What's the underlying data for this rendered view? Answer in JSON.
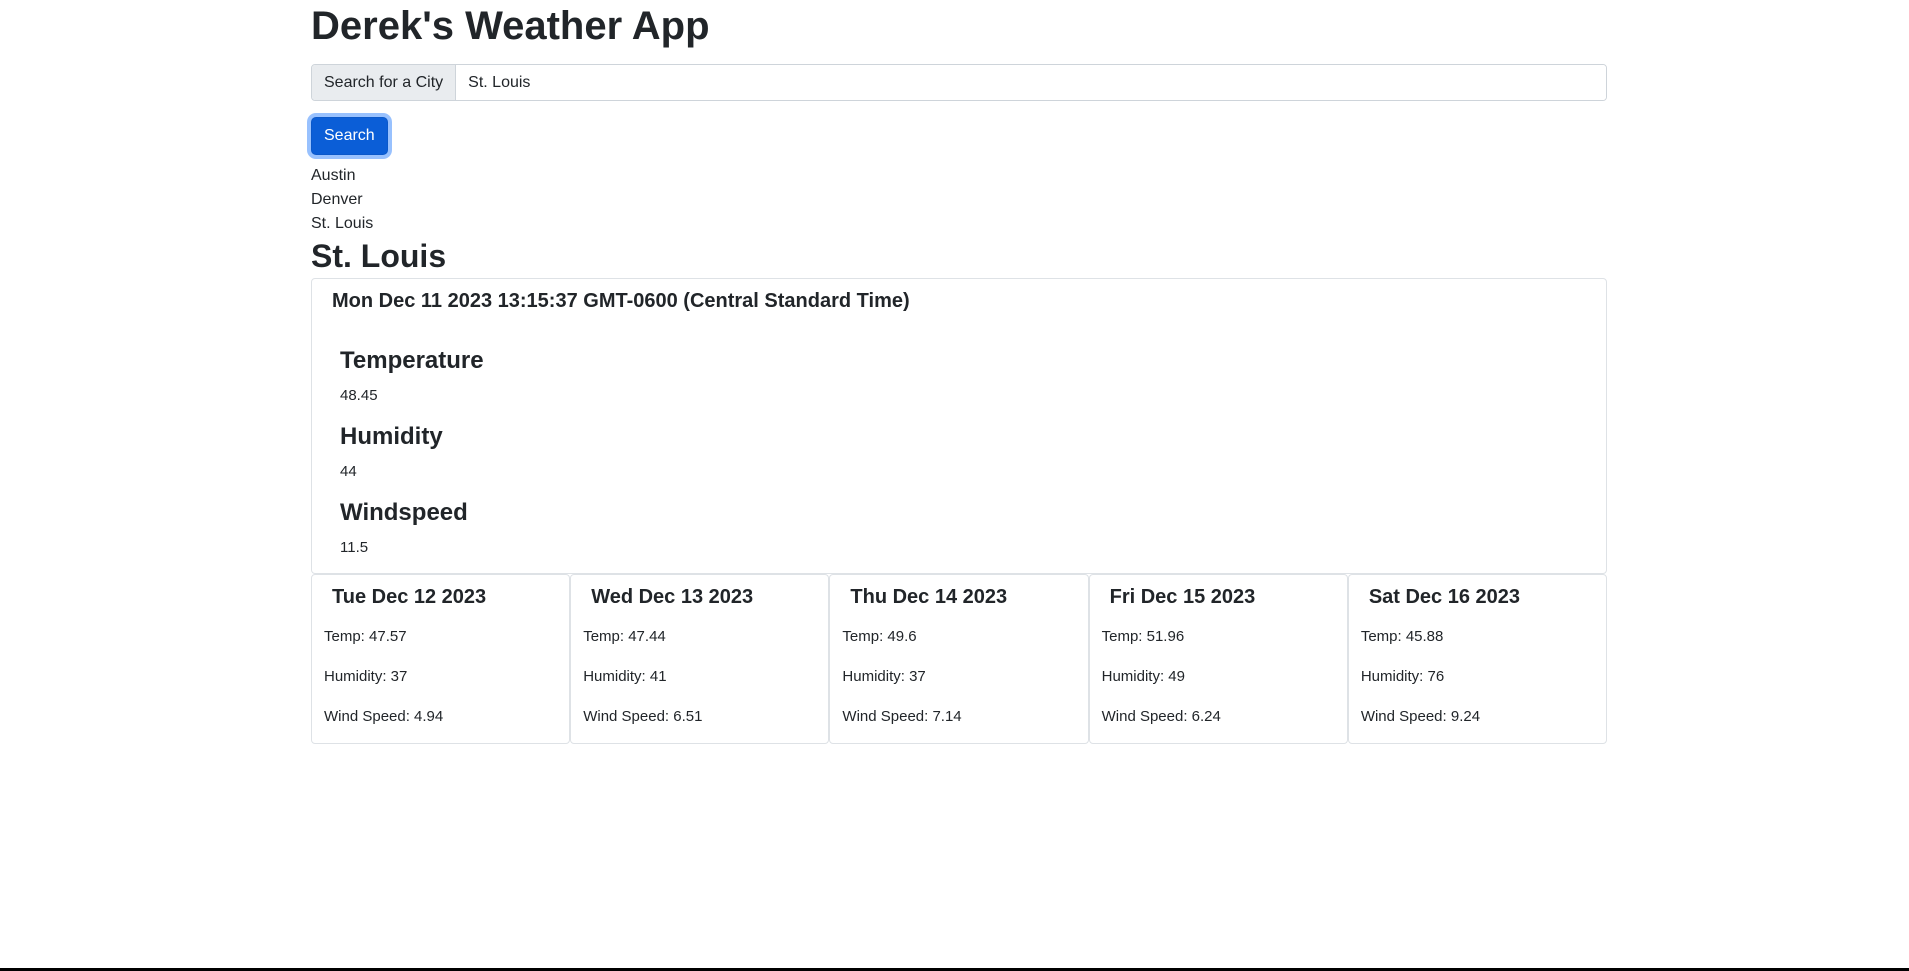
{
  "app": {
    "title": "Derek's Weather App"
  },
  "search": {
    "label": "Search for a City",
    "value": "St. Louis",
    "button_label": "Search"
  },
  "history": [
    "Austin",
    "Denver",
    "St. Louis"
  ],
  "current": {
    "city": "St. Louis",
    "datetime": "Mon Dec 11 2023 13:15:37 GMT-0600 (Central Standard Time)",
    "temperature_label": "Temperature",
    "temperature": "48.45",
    "humidity_label": "Humidity",
    "humidity": "44",
    "windspeed_label": "Windspeed",
    "windspeed": "11.5"
  },
  "forecast": [
    {
      "date": "Tue Dec 12 2023",
      "temp": "Temp: 47.57",
      "humidity": "Humidity: 37",
      "wind": "Wind Speed: 4.94"
    },
    {
      "date": "Wed Dec 13 2023",
      "temp": "Temp: 47.44",
      "humidity": "Humidity: 41",
      "wind": "Wind Speed: 6.51"
    },
    {
      "date": "Thu Dec 14 2023",
      "temp": "Temp: 49.6",
      "humidity": "Humidity: 37",
      "wind": "Wind Speed: 7.14"
    },
    {
      "date": "Fri Dec 15 2023",
      "temp": "Temp: 51.96",
      "humidity": "Humidity: 49",
      "wind": "Wind Speed: 6.24"
    },
    {
      "date": "Sat Dec 16 2023",
      "temp": "Temp: 45.88",
      "humidity": "Humidity: 76",
      "wind": "Wind Speed: 9.24"
    }
  ],
  "colors": {
    "accent": "#0b5ed7",
    "border": "#dee2e6",
    "text": "#212529"
  }
}
